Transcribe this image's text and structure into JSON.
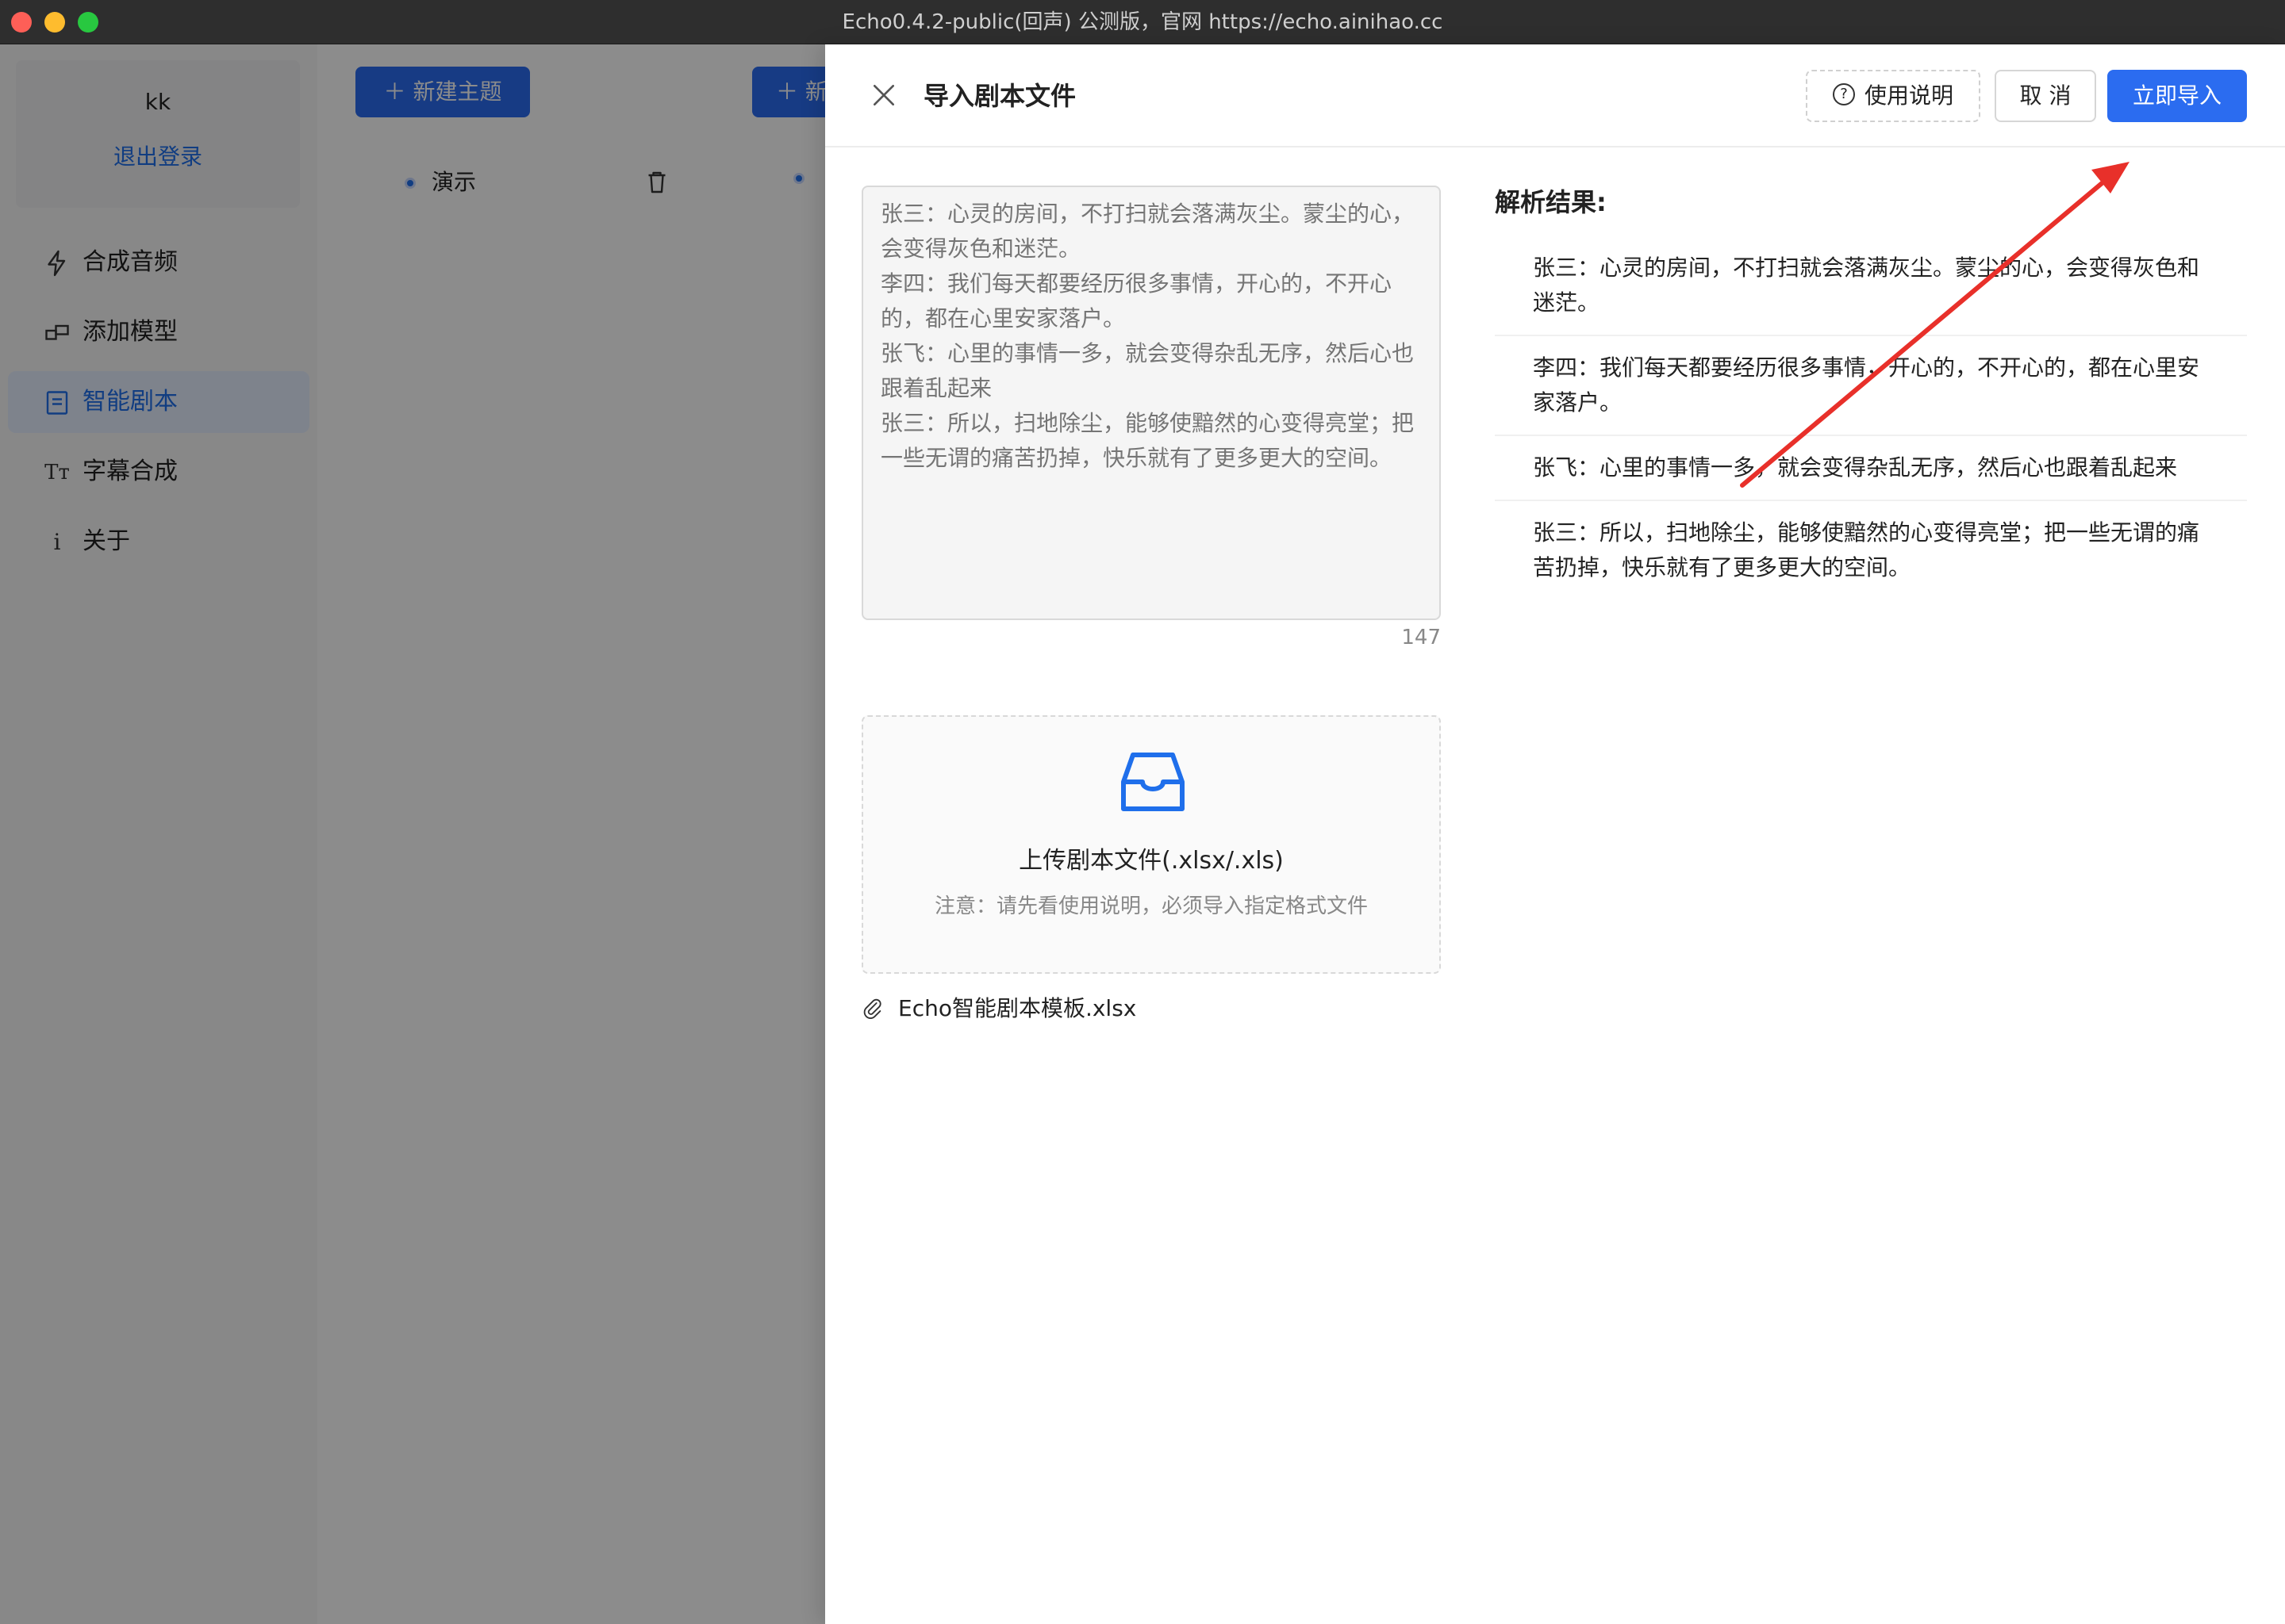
{
  "window": {
    "title": "Echo0.4.2-public(回声) 公测版，官网 https://echo.ainihao.cc"
  },
  "sidebar": {
    "user_name": "kk",
    "logout_label": "退出登录",
    "items": [
      {
        "label": "合成音频",
        "icon": "lightning-icon"
      },
      {
        "label": "添加模型",
        "icon": "model-icon"
      },
      {
        "label": "智能剧本",
        "icon": "script-icon",
        "active": true
      },
      {
        "label": "字幕合成",
        "icon": "text-icon"
      },
      {
        "label": "关于",
        "icon": "info-icon"
      }
    ]
  },
  "main": {
    "new_topic_label": "＋ 新建主题",
    "new_topic_label_2": "＋ 新",
    "topics": [
      {
        "label": "演示"
      }
    ]
  },
  "drawer": {
    "title": "导入剧本文件",
    "help_label": "使用说明",
    "cancel_label": "取 消",
    "import_label": "立即导入",
    "textarea_placeholder": "张三：心灵的房间，不打扫就会落满灰尘。蒙尘的心，会变得灰色和迷茫。\n李四：我们每天都要经历很多事情，开心的，不开心的，都在心里安家落户。\n张飞：心里的事情一多，就会变得杂乱无序，然后心也跟着乱起来\n张三：所以，扫地除尘，能够使黯然的心变得亮堂；把一些无谓的痛苦扔掉，快乐就有了更多更大的空间。",
    "char_count": "147",
    "upload_title": "上传剧本文件(.xlsx/.xls)",
    "upload_hint": "注意：请先看使用说明，必须导入指定格式文件",
    "attachment_name": "Echo智能剧本模板.xlsx",
    "result_title": "解析结果:",
    "results": [
      "张三：心灵的房间，不打扫就会落满灰尘。蒙尘的心，会变得灰色和迷茫。",
      "李四：我们每天都要经历很多事情，开心的，不开心的，都在心里安家落户。",
      "张飞：心里的事情一多，就会变得杂乱无序，然后心也跟着乱起来",
      "张三：所以，扫地除尘，能够使黯然的心变得亮堂；把一些无谓的痛苦扔掉，快乐就有了更多更大的空间。"
    ]
  },
  "colors": {
    "accent": "#2b6cf0",
    "annotation_arrow": "#e8302a"
  }
}
